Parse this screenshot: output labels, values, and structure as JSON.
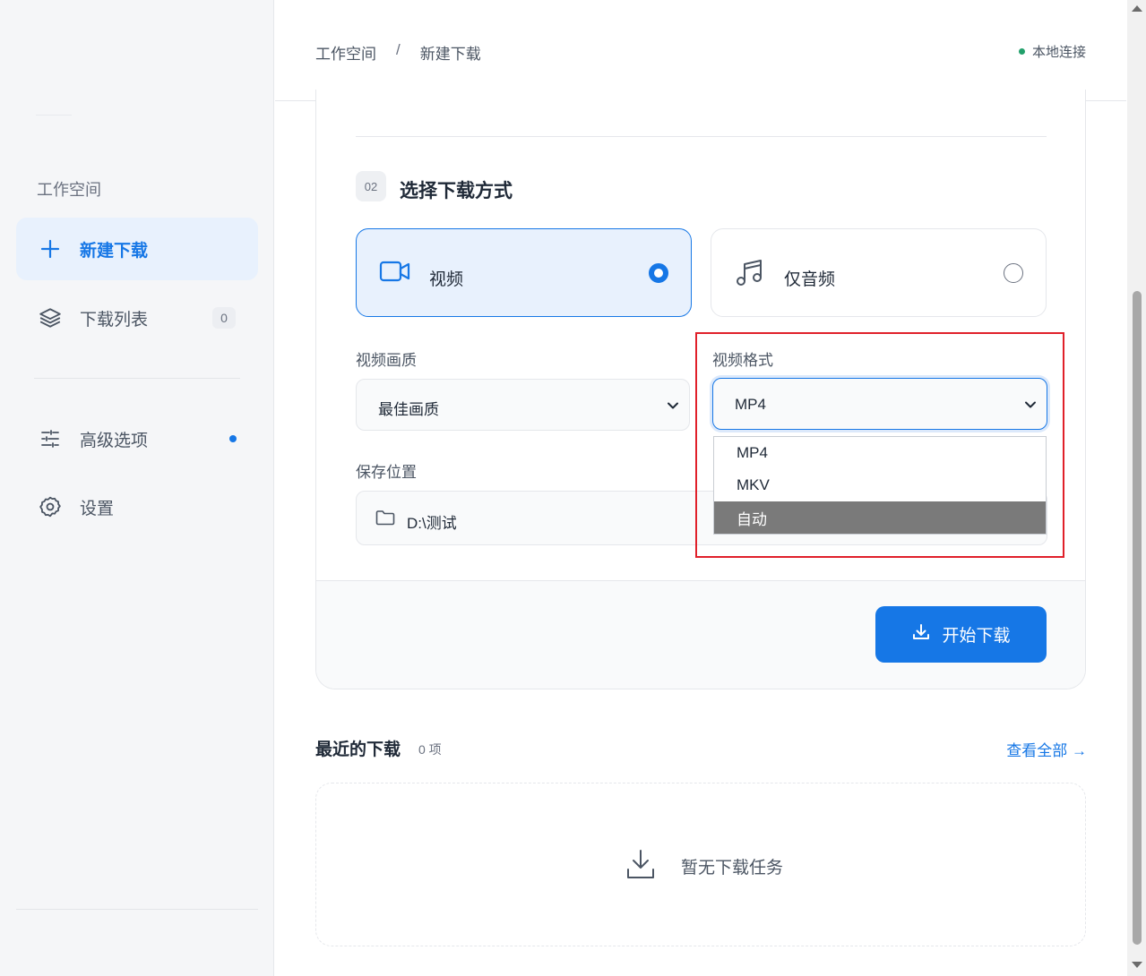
{
  "sidebar": {
    "section_title": "工作空间",
    "items": [
      {
        "label": "新建下载",
        "icon": "plus-icon"
      },
      {
        "label": "下载列表",
        "icon": "layers-icon",
        "count": "0"
      },
      {
        "label": "高级选项",
        "icon": "sliders-icon"
      },
      {
        "label": "设置",
        "icon": "gear-icon"
      }
    ]
  },
  "header": {
    "breadcrumb": [
      "工作空间",
      "新建下载"
    ],
    "breadcrumb_sep": "/",
    "status": "本地连接"
  },
  "form": {
    "step_number": "02",
    "step_title": "选择下载方式",
    "modes": [
      {
        "label": "视频",
        "icon": "video-camera-icon",
        "selected": true
      },
      {
        "label": "仅音频",
        "icon": "music-note-icon",
        "selected": false
      }
    ],
    "quality_label": "视频画质",
    "quality_value": "最佳画质",
    "format_label": "视频格式",
    "format_value": "MP4",
    "format_options": [
      "MP4",
      "MKV",
      "自动"
    ],
    "format_highlighted": "自动",
    "save_label": "保存位置",
    "save_path": "D:\\测试",
    "start_button": "开始下载"
  },
  "recent": {
    "title": "最近的下载",
    "count": "0 项",
    "view_all": "查看全部 →",
    "empty_text": "暂无下载任务"
  },
  "colors": {
    "accent": "#1677e6",
    "status_dot": "#22a06b",
    "highlight_box": "#e0202a"
  }
}
